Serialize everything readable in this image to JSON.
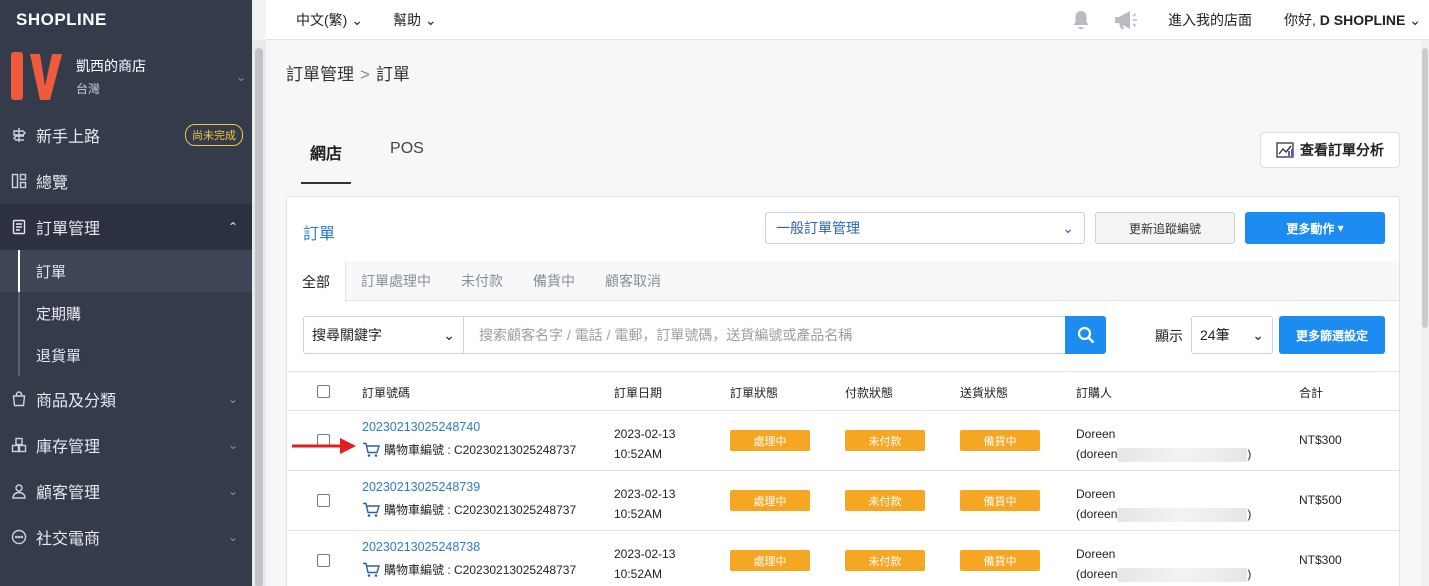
{
  "brand": "SHOPLINE",
  "store": {
    "name": "凱西的商店",
    "region": "台灣"
  },
  "sidebar": {
    "items": [
      {
        "label": "新手上路",
        "icon": "signpost-icon",
        "badge": "尚未完成"
      },
      {
        "label": "總覽",
        "icon": "dashboard-icon"
      },
      {
        "label": "訂單管理",
        "icon": "document-icon",
        "expanded": true,
        "children": [
          {
            "label": "訂單",
            "active": true
          },
          {
            "label": "定期購"
          },
          {
            "label": "退貨單"
          }
        ]
      },
      {
        "label": "商品及分類",
        "icon": "bag-icon"
      },
      {
        "label": "庫存管理",
        "icon": "inventory-icon"
      },
      {
        "label": "顧客管理",
        "icon": "person-icon"
      },
      {
        "label": "社交電商",
        "icon": "chat-icon"
      }
    ]
  },
  "topbar": {
    "language": "中文(繁)",
    "help": "幫助",
    "visit_store": "進入我的店面",
    "greeting": "你好,",
    "user": "D SHOPLINE"
  },
  "breadcrumb": {
    "parent": "訂單管理",
    "separator": ">",
    "current": "訂單"
  },
  "channel_tabs": [
    {
      "label": "網店",
      "active": true
    },
    {
      "label": "POS"
    }
  ],
  "analytics_button": "查看訂單分析",
  "orders_card": {
    "title": "訂單",
    "mode_select": "一般訂單管理",
    "update_tracking_button": "更新追蹤編號",
    "more_actions_button": "更多動作",
    "status_tabs": [
      {
        "label": "全部",
        "active": true
      },
      {
        "label": "訂單處理中"
      },
      {
        "label": "未付款"
      },
      {
        "label": "備貨中"
      },
      {
        "label": "顧客取消"
      }
    ],
    "search": {
      "field_select": "搜尋關鍵字",
      "placeholder": "搜索顧客名字 / 電話 / 電郵，訂單號碼，送貨編號或產品名稱",
      "show_label": "顯示",
      "page_size": "24筆",
      "filter_button": "更多篩選設定"
    },
    "columns": [
      "訂單號碼",
      "訂單日期",
      "訂單狀態",
      "付款狀態",
      "送貨狀態",
      "訂購人",
      "合計"
    ],
    "rows": [
      {
        "order_no": "20230213025248740",
        "cart": "購物車編號 : C20230213025248737",
        "date": "2023-02-13",
        "time": "10:52AM",
        "order_status": "處理中",
        "payment_status": "未付款",
        "delivery_status": "備貨中",
        "buyer_name": "Doreen",
        "buyer_email_prefix": "(doreen",
        "buyer_email_suffix": ")",
        "total": "NT$300"
      },
      {
        "order_no": "20230213025248739",
        "cart": "購物車編號 : C20230213025248737",
        "date": "2023-02-13",
        "time": "10:52AM",
        "order_status": "處理中",
        "payment_status": "未付款",
        "delivery_status": "備貨中",
        "buyer_name": "Doreen",
        "buyer_email_prefix": "(doreen",
        "buyer_email_suffix": ")",
        "total": "NT$500"
      },
      {
        "order_no": "20230213025248738",
        "cart": "購物車編號 : C20230213025248737",
        "date": "2023-02-13",
        "time": "10:52AM",
        "order_status": "處理中",
        "payment_status": "未付款",
        "delivery_status": "備貨中",
        "buyer_name": "Doreen",
        "buyer_email_prefix": "(doreen",
        "buyer_email_suffix": ")",
        "total": "NT$300"
      }
    ]
  },
  "colors": {
    "sidebar": "#343b4b",
    "primary": "#1d8cf0",
    "link": "#2d7bc6",
    "status_pill": "#f5a623",
    "annotation_arrow": "#e02020",
    "store_logo": "#ef5a3c"
  }
}
